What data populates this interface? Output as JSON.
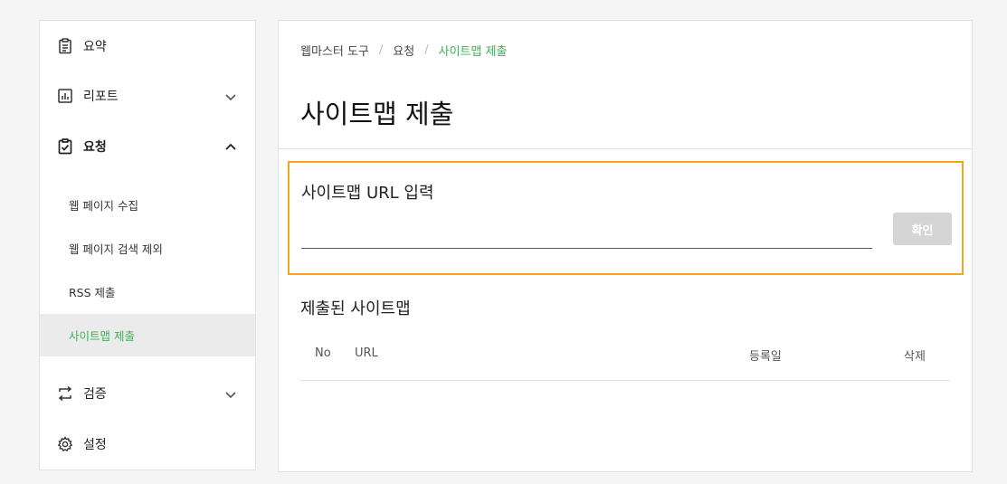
{
  "sidebar": {
    "items": [
      {
        "label": "요약",
        "icon": "clipboard-icon"
      },
      {
        "label": "리포트",
        "icon": "bar-chart-icon",
        "expanded": false
      },
      {
        "label": "요청",
        "icon": "clipboard-check-icon",
        "expanded": true
      },
      {
        "label": "검증",
        "icon": "swap-arrows-icon",
        "expanded": false
      },
      {
        "label": "설정",
        "icon": "gear-icon"
      }
    ],
    "sub_items": [
      "웹 페이지 수집",
      "웹 페이지 검색 제외",
      "RSS 제출",
      "사이트맵 제출"
    ],
    "active_sub_item": "사이트맵 제출"
  },
  "breadcrumb": {
    "items": [
      "웹마스터 도구",
      "요청",
      "사이트맵 제출"
    ],
    "separator": "/"
  },
  "page": {
    "title": "사이트맵 제출"
  },
  "submit": {
    "label": "사이트맵 URL 입력",
    "input_value": "",
    "placeholder": "",
    "button_label": "확인"
  },
  "list": {
    "title": "제출된 사이트맵",
    "columns": [
      "No",
      "URL",
      "등록일",
      "삭제"
    ],
    "rows": []
  },
  "colors": {
    "accent": "#3cb253",
    "highlight_border": "#f3a51c",
    "disabled_button": "#d5d5d5",
    "active_bg": "#ebebeb"
  }
}
